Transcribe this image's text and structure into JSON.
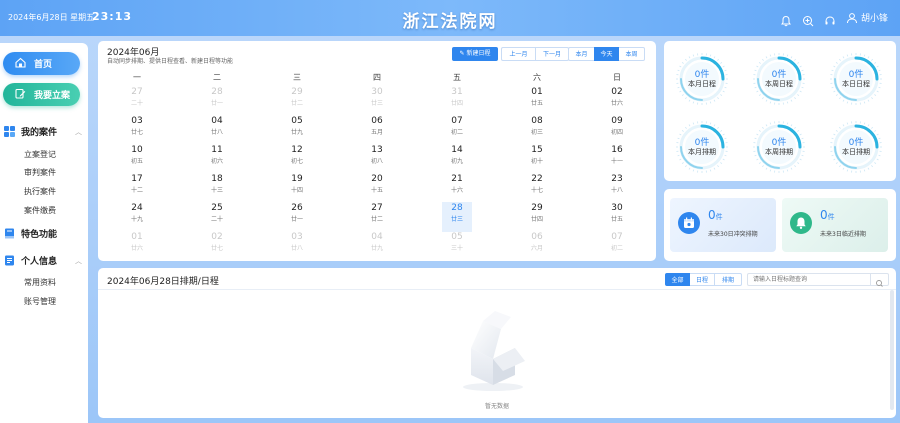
{
  "header": {
    "date": "2024年6月28日 星期五",
    "time": "23:13",
    "title": "浙江法院网",
    "user": "胡小锋"
  },
  "sidebar": {
    "home": "首页",
    "file_case": "我要立案",
    "sections": [
      {
        "label": "我的案件",
        "items": [
          "立案登记",
          "审判案件",
          "执行案件",
          "案件缴费"
        ]
      },
      {
        "label": "特色功能",
        "items": []
      },
      {
        "label": "个人信息",
        "items": [
          "常用资料",
          "账号管理"
        ]
      }
    ]
  },
  "calendar": {
    "month_title": "2024年06月",
    "description": "自动同步排期、提供日程查看、新建日程等功能",
    "buttons": {
      "new": "新建日程",
      "prev": "上一月",
      "next": "下一月",
      "month": "本月",
      "today": "今天",
      "week": "本周"
    },
    "weekdays": [
      "一",
      "二",
      "三",
      "四",
      "五",
      "六",
      "日"
    ],
    "weeks": [
      [
        {
          "d": "27",
          "l": "二十",
          "o": true
        },
        {
          "d": "28",
          "l": "廿一",
          "o": true
        },
        {
          "d": "29",
          "l": "廿二",
          "o": true
        },
        {
          "d": "30",
          "l": "廿三",
          "o": true
        },
        {
          "d": "31",
          "l": "廿四",
          "o": true
        },
        {
          "d": "01",
          "l": "廿五"
        },
        {
          "d": "02",
          "l": "廿六"
        }
      ],
      [
        {
          "d": "03",
          "l": "廿七"
        },
        {
          "d": "04",
          "l": "廿八"
        },
        {
          "d": "05",
          "l": "廿九"
        },
        {
          "d": "06",
          "l": "五月"
        },
        {
          "d": "07",
          "l": "初二"
        },
        {
          "d": "08",
          "l": "初三"
        },
        {
          "d": "09",
          "l": "初四"
        }
      ],
      [
        {
          "d": "10",
          "l": "初五"
        },
        {
          "d": "11",
          "l": "初六"
        },
        {
          "d": "12",
          "l": "初七"
        },
        {
          "d": "13",
          "l": "初八"
        },
        {
          "d": "14",
          "l": "初九"
        },
        {
          "d": "15",
          "l": "初十"
        },
        {
          "d": "16",
          "l": "十一"
        }
      ],
      [
        {
          "d": "17",
          "l": "十二"
        },
        {
          "d": "18",
          "l": "十三"
        },
        {
          "d": "19",
          "l": "十四"
        },
        {
          "d": "20",
          "l": "十五"
        },
        {
          "d": "21",
          "l": "十六"
        },
        {
          "d": "22",
          "l": "十七"
        },
        {
          "d": "23",
          "l": "十八"
        }
      ],
      [
        {
          "d": "24",
          "l": "十九"
        },
        {
          "d": "25",
          "l": "二十"
        },
        {
          "d": "26",
          "l": "廿一"
        },
        {
          "d": "27",
          "l": "廿二"
        },
        {
          "d": "28",
          "l": "廿三",
          "t": true
        },
        {
          "d": "29",
          "l": "廿四"
        },
        {
          "d": "30",
          "l": "廿五"
        }
      ],
      [
        {
          "d": "01",
          "l": "廿六",
          "o": true
        },
        {
          "d": "02",
          "l": "廿七",
          "o": true
        },
        {
          "d": "03",
          "l": "廿八",
          "o": true
        },
        {
          "d": "04",
          "l": "廿九",
          "o": true
        },
        {
          "d": "05",
          "l": "三十",
          "o": true
        },
        {
          "d": "06",
          "l": "六月",
          "o": true
        },
        {
          "d": "07",
          "l": "初二",
          "o": true
        }
      ]
    ]
  },
  "stats": {
    "rings": [
      {
        "value": "0件",
        "label": "本月日程"
      },
      {
        "value": "0件",
        "label": "本周日程"
      },
      {
        "value": "0件",
        "label": "本日日程"
      },
      {
        "value": "0件",
        "label": "本月排期"
      },
      {
        "value": "0件",
        "label": "本周排期"
      },
      {
        "value": "0件",
        "label": "本日排期"
      }
    ],
    "cards": [
      {
        "value": "0",
        "unit": "件",
        "label": "未来30日冲突排期"
      },
      {
        "value": "0",
        "unit": "件",
        "label": "未来3日临近排期"
      }
    ]
  },
  "schedule": {
    "title": "2024年06月28日排期/日程",
    "tabs": [
      "全部",
      "日程",
      "排期"
    ],
    "search_placeholder": "请输入日程标题查询",
    "empty_text": "暂无数据"
  },
  "colors": {
    "accent": "#2f86ee",
    "teal": "#22b59a",
    "ring": "#2bb3e0"
  }
}
